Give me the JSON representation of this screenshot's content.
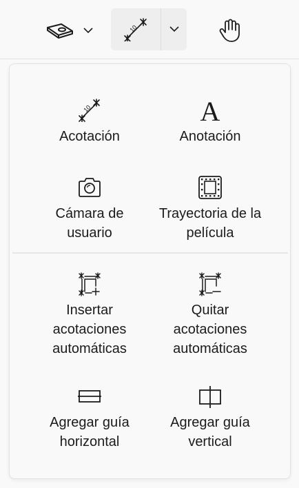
{
  "toolbar": {
    "items": [
      {
        "name": "surface-tool",
        "icon": "surface-plate-icon",
        "has_dropdown": true
      },
      {
        "name": "dimension-tool",
        "icon": "dimension-icon",
        "has_dropdown": true,
        "selected": true
      },
      {
        "name": "pan-tool",
        "icon": "hand-icon",
        "has_dropdown": false
      }
    ]
  },
  "panel": {
    "tools": [
      {
        "label": "Acotación",
        "icon": "dimension-icon"
      },
      {
        "label": "Anotación",
        "icon": "text-annotation-icon"
      },
      {
        "label": "Cámara de usuario",
        "icon": "camera-icon"
      },
      {
        "label": "Trayectoria de la película",
        "icon": "film-strip-icon"
      },
      {
        "label": "Insertar acotaciones automáticas",
        "icon": "auto-dimension-add-icon"
      },
      {
        "label": "Quitar acotaciones automáticas",
        "icon": "auto-dimension-remove-icon"
      },
      {
        "label": "Agregar guía horizontal",
        "icon": "horizontal-guide-icon"
      },
      {
        "label": "Agregar guía vertical",
        "icon": "vertical-guide-icon"
      }
    ]
  },
  "colors": {
    "background": "#f9f9f9",
    "selected_button": "#eeeeee",
    "text": "#1b1b1b",
    "divider": "#e6e6e6"
  }
}
